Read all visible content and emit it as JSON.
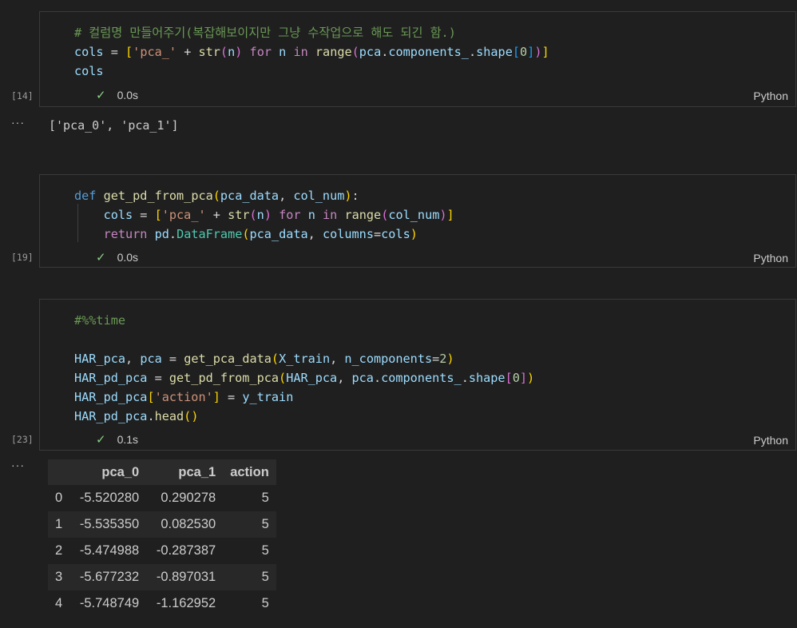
{
  "cells": [
    {
      "exec_count": "[14]",
      "status": "0.0s",
      "language": "Python",
      "lines": [
        "# 컬럼명 만들어주기(복잡해보이지만 그냥 수작업으로 해도 되긴 함.)",
        "cols = ['pca_' + str(n) for n in range(pca.components_.shape[0])]",
        "cols"
      ],
      "output": "['pca_0', 'pca_1']"
    },
    {
      "exec_count": "[19]",
      "status": "0.0s",
      "language": "Python",
      "lines": [
        "def get_pd_from_pca(pca_data, col_num):",
        "    cols = ['pca_' + str(n) for n in range(col_num)]",
        "    return pd.DataFrame(pca_data, columns=cols)"
      ]
    },
    {
      "exec_count": "[23]",
      "status": "0.1s",
      "language": "Python",
      "lines": [
        "#%%time",
        "",
        "HAR_pca, pca = get_pca_data(X_train, n_components=2)",
        "HAR_pd_pca = get_pd_from_pca(HAR_pca, pca.components_.shape[0])",
        "HAR_pd_pca['action'] = y_train",
        "HAR_pd_pca.head()"
      ]
    }
  ],
  "output_ellipsis": "···",
  "dataframe": {
    "columns": [
      "",
      "pca_0",
      "pca_1",
      "action"
    ],
    "rows": [
      [
        "0",
        "-5.520280",
        "0.290278",
        "5"
      ],
      [
        "1",
        "-5.535350",
        "0.082530",
        "5"
      ],
      [
        "2",
        "-5.474988",
        "-0.287387",
        "5"
      ],
      [
        "3",
        "-5.677232",
        "-0.897031",
        "5"
      ],
      [
        "4",
        "-5.748749",
        "-1.162952",
        "5"
      ]
    ]
  },
  "colors": {
    "background": "#1f1f1f",
    "cell_border": "#3a3a3a",
    "success_check": "#89d185",
    "keyword": "#569cd6",
    "function": "#dcdcaa",
    "variable": "#9cdcfe",
    "string": "#ce9178",
    "number": "#b5cea8",
    "comment": "#6a9955"
  },
  "icons": {
    "status": "check-icon",
    "more": "ellipsis-icon"
  }
}
